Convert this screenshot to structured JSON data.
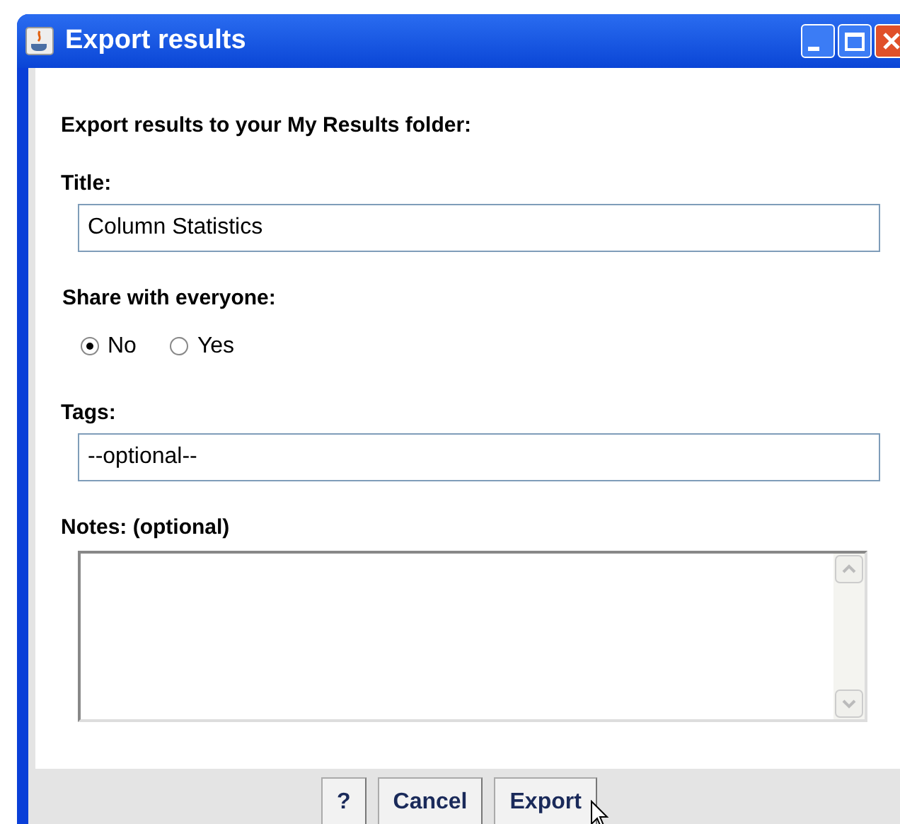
{
  "window": {
    "title": "Export results"
  },
  "heading": "Export results to your My Results folder:",
  "title_field": {
    "label": "Title:",
    "value": "Column Statistics"
  },
  "share": {
    "label": "Share with everyone:",
    "options": [
      {
        "label": "No",
        "selected": true
      },
      {
        "label": "Yes",
        "selected": false
      }
    ]
  },
  "tags_field": {
    "label": "Tags:",
    "value": "--optional--"
  },
  "notes_field": {
    "label": "Notes: (optional)"
  },
  "buttons": [
    {
      "label": "?"
    },
    {
      "label": "Cancel"
    },
    {
      "label": "Export"
    }
  ]
}
